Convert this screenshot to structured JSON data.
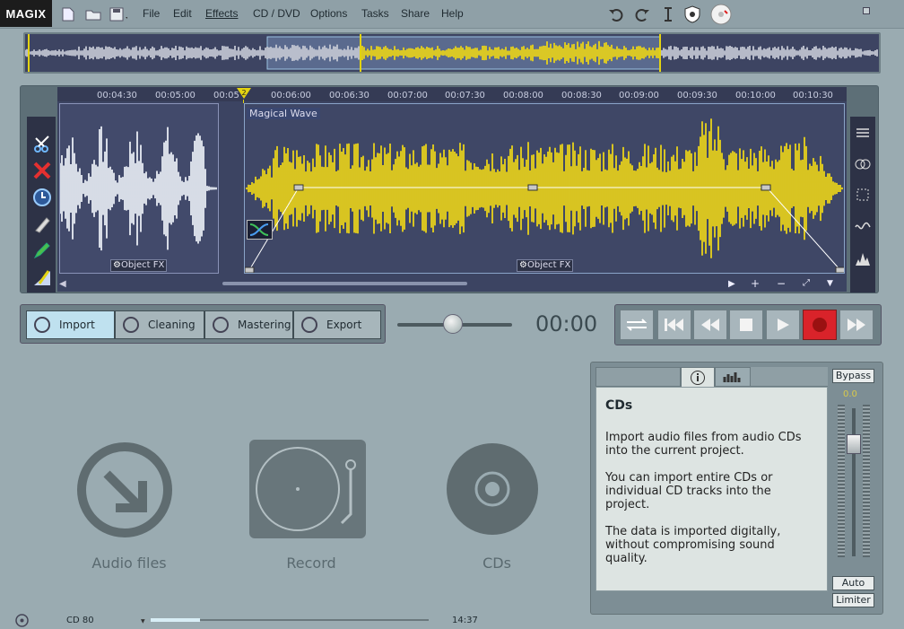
{
  "app": {
    "logo": "MAGIX"
  },
  "menu": {
    "items": [
      "File",
      "Edit",
      "Effects",
      "CD / DVD",
      "Options",
      "Tasks",
      "Share",
      "Help"
    ]
  },
  "timeline": {
    "ticks": [
      "00:04:30",
      "00:05:00",
      "00:05",
      "00:06:00",
      "00:06:30",
      "00:07:00",
      "00:07:30",
      "00:08:00",
      "00:08:30",
      "00:09:00",
      "00:09:30",
      "00:10:00",
      "00:10:30"
    ],
    "marker": "2",
    "object_name": "Magical Wave",
    "object_fx_label": "Object FX"
  },
  "tabs": [
    {
      "label": "Import",
      "active": true
    },
    {
      "label": "Cleaning",
      "active": false
    },
    {
      "label": "Mastering",
      "active": false
    },
    {
      "label": "Export",
      "active": false
    }
  ],
  "time_display": "00:00",
  "sources": {
    "audio_files": "Audio files",
    "record": "Record",
    "cds": "CDs"
  },
  "info": {
    "title": "CDs",
    "paragraphs": [
      "Import audio files from audio CDs into the current project.",
      "You can import entire CDs or individual CD tracks into the project.",
      "The data is imported digitally, without compromising sound quality."
    ],
    "bypass_label": "Bypass",
    "level_value": "0.0",
    "auto_label": "Auto",
    "limiter_label": "Limiter"
  },
  "status": {
    "disc_type": "CD 80",
    "duration": "14:37"
  },
  "colors": {
    "wave_yellow": "#e9d31a",
    "wave_white": "#e8ecf4",
    "record_red": "#d9232a",
    "active_tab": "#bfe1ef"
  }
}
